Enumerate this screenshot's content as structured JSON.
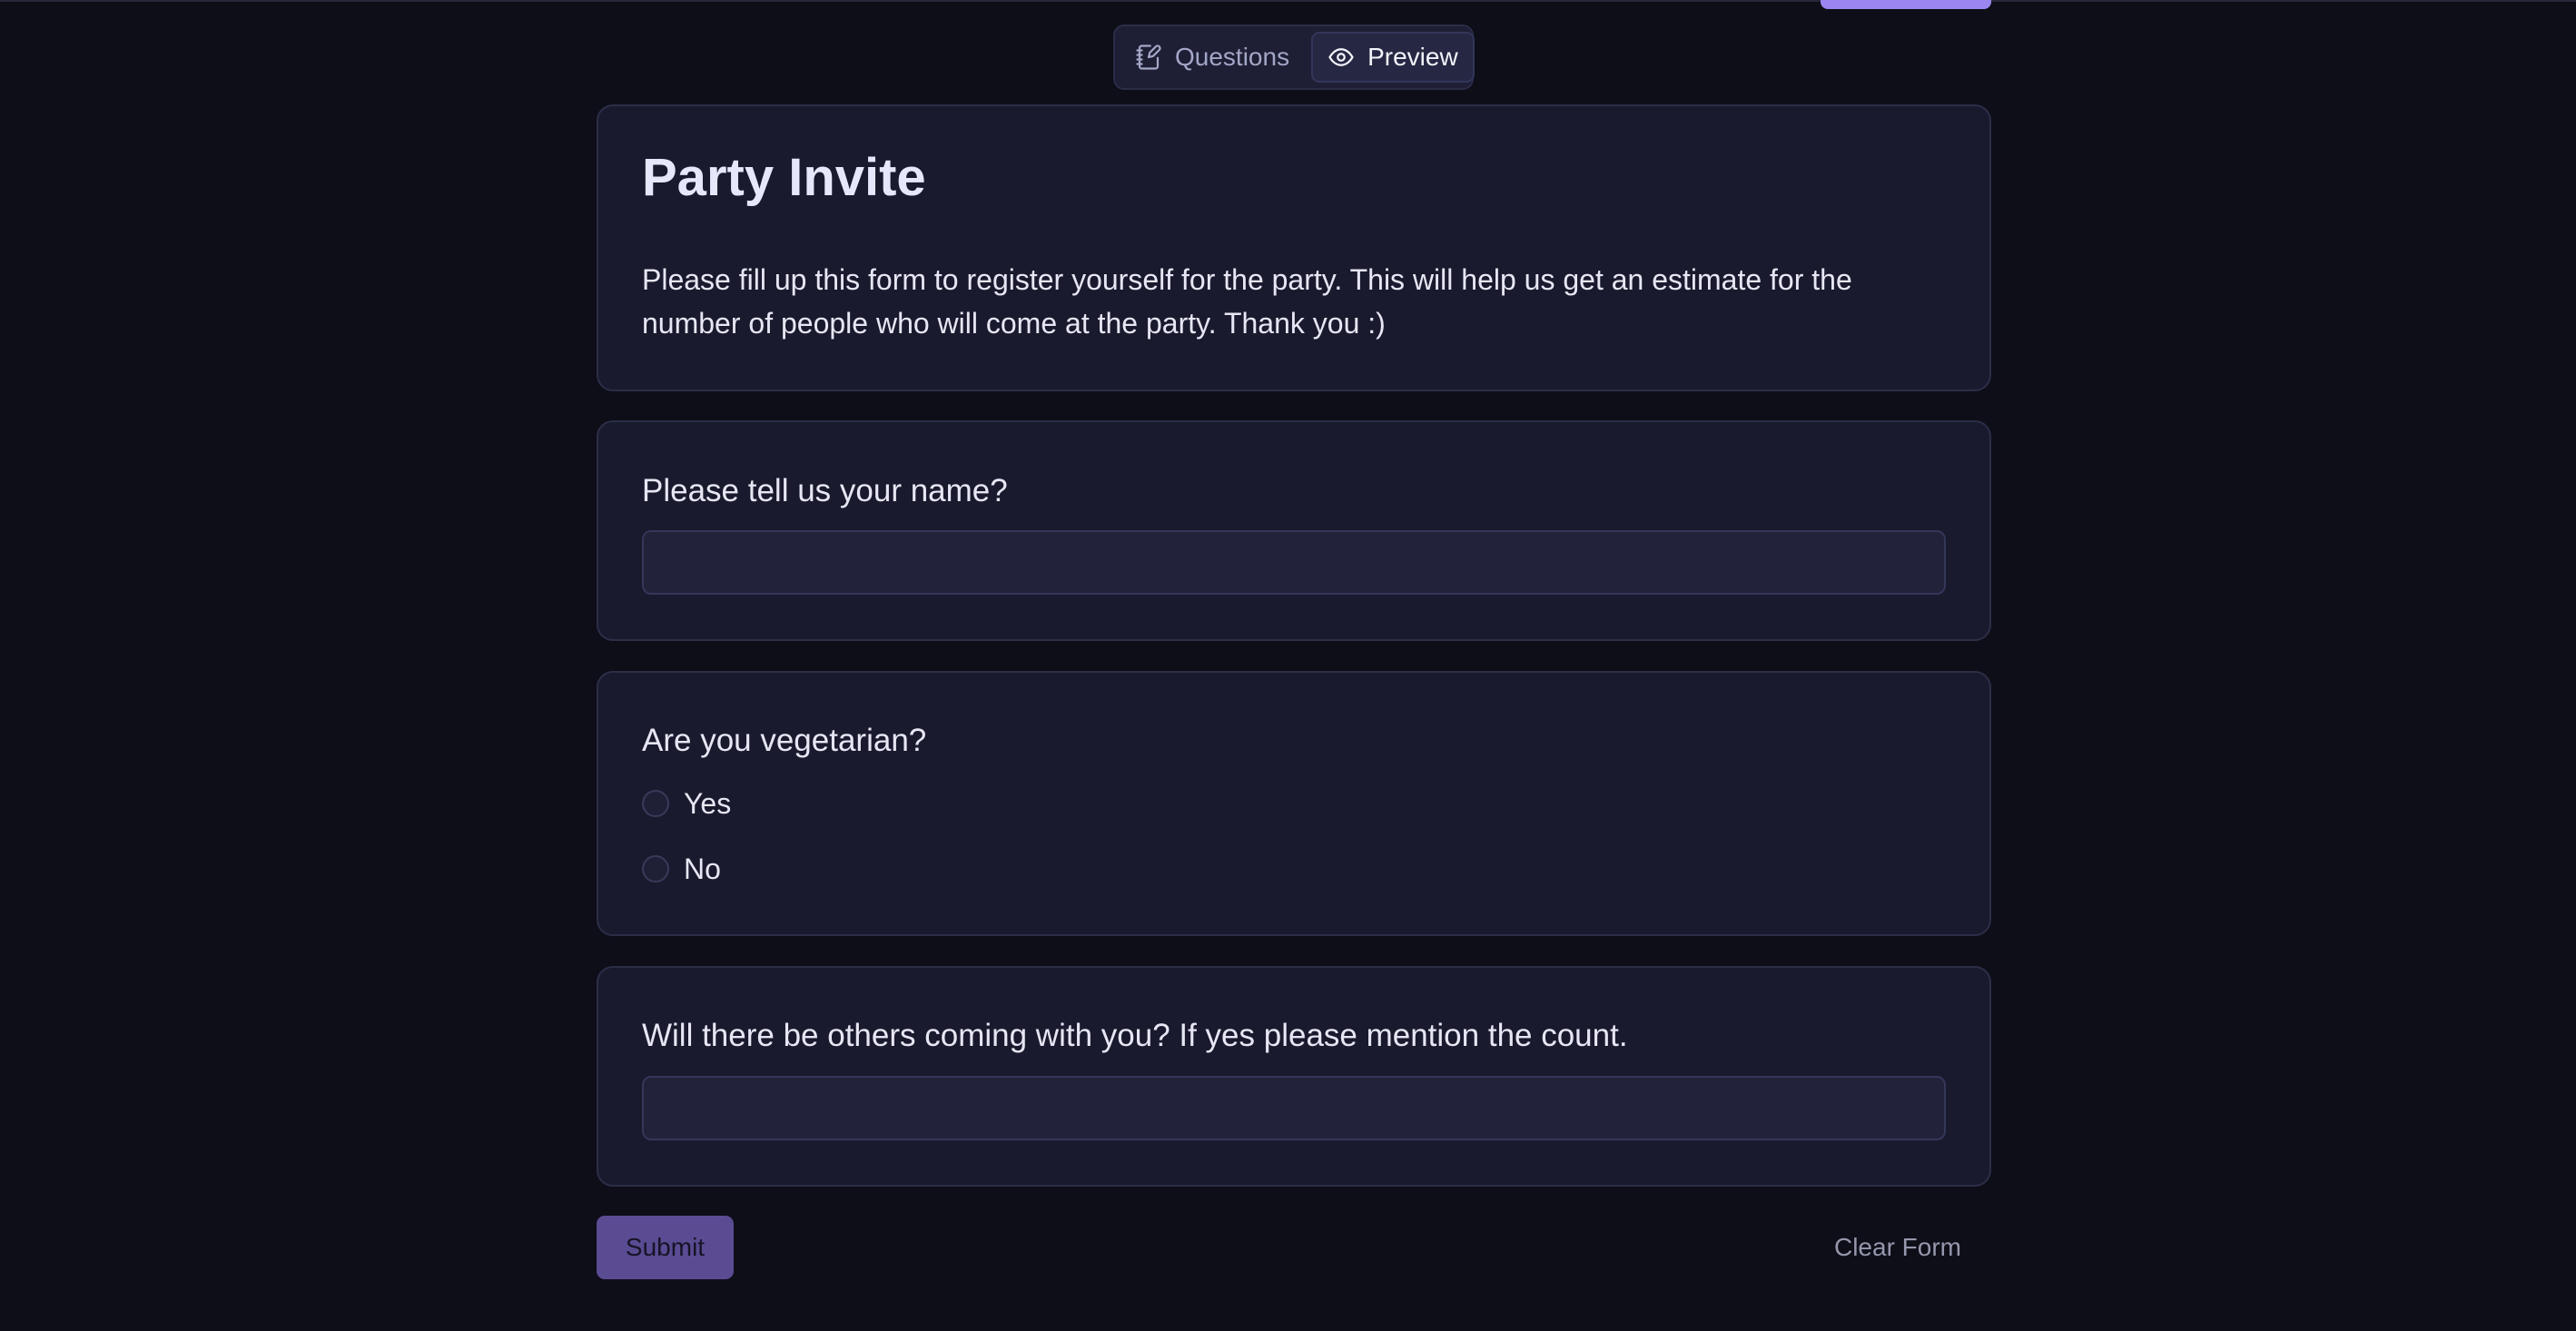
{
  "toggle": {
    "questions_label": "Questions",
    "questions_icon": "notebook-pen-icon",
    "preview_label": "Preview",
    "preview_icon": "eye-icon",
    "active": "Preview"
  },
  "form": {
    "title": "Party Invite",
    "description": "Please fill up this form to register yourself for the party. This will help us get an estimate for the number of people who will come at the party. Thank you :)"
  },
  "questions": [
    {
      "label": "Please tell us your name?",
      "type": "text",
      "value": ""
    },
    {
      "label": "Are you vegetarian?",
      "type": "radio",
      "options": [
        "Yes",
        "No"
      ],
      "selected": null
    },
    {
      "label": "Will there be others coming with you? If yes please mention the count.",
      "type": "text",
      "value": ""
    }
  ],
  "actions": {
    "submit_label": "Submit",
    "clear_label": "Clear Form"
  },
  "colors": {
    "background": "#0d0e18",
    "card": "#1a1a2e",
    "accent": "#9b86f0",
    "submit": "#5b4b93"
  }
}
